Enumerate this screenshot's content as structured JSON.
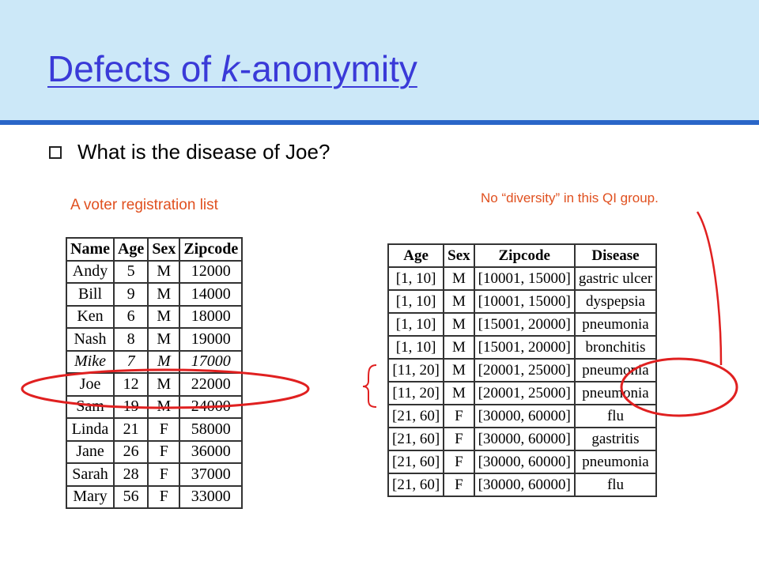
{
  "slide": {
    "title_prefix": "Defects of ",
    "title_k": "k",
    "title_suffix": "-anonymity",
    "bullet": "What is the disease of Joe?",
    "voter_caption": "A voter registration list",
    "annotation": "No “diversity” in this QI group."
  },
  "voter_table": {
    "headers": [
      "Name",
      "Age",
      "Sex",
      "Zipcode"
    ],
    "rows": [
      [
        "Andy",
        "5",
        "M",
        "12000"
      ],
      [
        "Bill",
        "9",
        "M",
        "14000"
      ],
      [
        "Ken",
        "6",
        "M",
        "18000"
      ],
      [
        "Nash",
        "8",
        "M",
        "19000"
      ],
      [
        "Mike",
        "7",
        "M",
        "17000"
      ],
      [
        "Joe",
        "12",
        "M",
        "22000"
      ],
      [
        "Sam",
        "19",
        "M",
        "24000"
      ],
      [
        "Linda",
        "21",
        "F",
        "58000"
      ],
      [
        "Jane",
        "26",
        "F",
        "36000"
      ],
      [
        "Sarah",
        "28",
        "F",
        "37000"
      ],
      [
        "Mary",
        "56",
        "F",
        "33000"
      ]
    ]
  },
  "anon_table": {
    "headers": [
      "Age",
      "Sex",
      "Zipcode",
      "Disease"
    ],
    "rows": [
      [
        "[1, 10]",
        "M",
        "[10001, 15000]",
        "gastric ulcer"
      ],
      [
        "[1, 10]",
        "M",
        "[10001, 15000]",
        "dyspepsia"
      ],
      [
        "[1, 10]",
        "M",
        "[15001, 20000]",
        "pneumonia"
      ],
      [
        "[1, 10]",
        "M",
        "[15001, 20000]",
        "bronchitis"
      ],
      [
        "[11, 20]",
        "M",
        "[20001, 25000]",
        "pneumonia"
      ],
      [
        "[11, 20]",
        "M",
        "[20001, 25000]",
        "pneumonia"
      ],
      [
        "[21, 60]",
        "F",
        "[30000, 60000]",
        "flu"
      ],
      [
        "[21, 60]",
        "F",
        "[30000, 60000]",
        "gastritis"
      ],
      [
        "[21, 60]",
        "F",
        "[30000, 60000]",
        "pneumonia"
      ],
      [
        "[21, 60]",
        "F",
        "[30000, 60000]",
        "flu"
      ]
    ]
  },
  "colors": {
    "header_bg": "#cce8f8",
    "header_rule": "#2a66c8",
    "title": "#3a3ad8",
    "caption": "#e0501f",
    "highlight": "#e02020"
  }
}
